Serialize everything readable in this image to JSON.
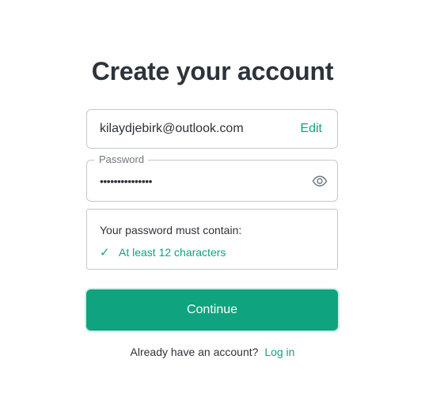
{
  "page": {
    "title": "Create your account"
  },
  "email": {
    "value": "kilaydjebirk@outlook.com",
    "edit_label": "Edit"
  },
  "password": {
    "label": "Password",
    "masked_value": "•••••••••••••••",
    "toggle_icon": "eye-icon"
  },
  "rules": {
    "title": "Your password must contain:",
    "items": [
      {
        "check_icon": "✓",
        "text": "At least 12 characters",
        "satisfied": true
      }
    ]
  },
  "actions": {
    "continue_label": "Continue"
  },
  "footer": {
    "prompt": "Already have an account?",
    "login_label": "Log in"
  },
  "colors": {
    "accent": "#10a37f",
    "text": "#2d333a",
    "border": "#c2c8d0"
  }
}
